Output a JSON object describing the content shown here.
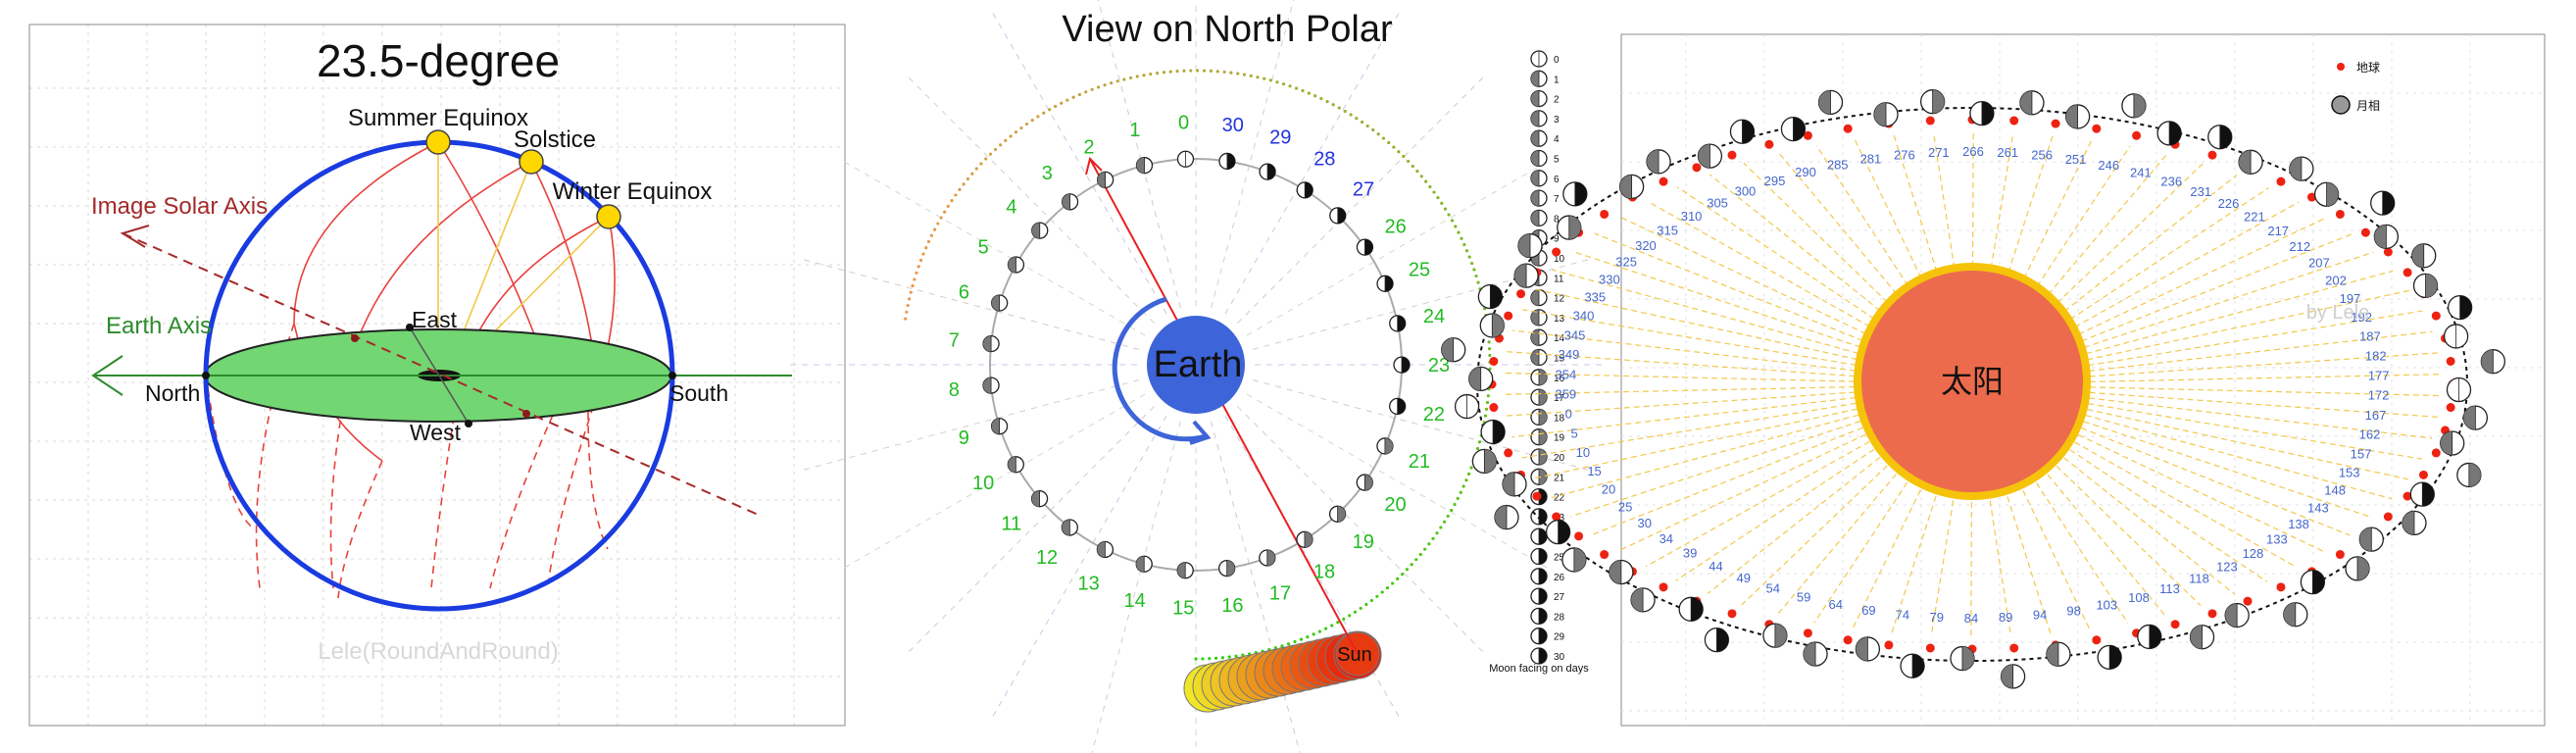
{
  "panel1": {
    "title": "23.5-degree",
    "summer_equinox": "Summer Equinox",
    "solstice": "Solstice",
    "winter_equinox": "Winter Equinox",
    "image_solar_axis": "Image Solar Axis",
    "earth_axis": "Earth Axis",
    "north": "North",
    "south": "South",
    "east": "East",
    "west": "West",
    "watermark": "Lele(RoundAndRound)",
    "colors": {
      "sphere": "#1a3be0",
      "disk": "#72d672",
      "arc": "#e8413c",
      "solar_axis": "#a52a2a",
      "sun": "#ffd700",
      "earth_axis": "#2e8b2e"
    }
  },
  "panel2": {
    "title": "View on North Polar",
    "earth_label": "Earth",
    "sun_label": "Sun",
    "green_days": [
      "0",
      "1",
      "2",
      "3",
      "4",
      "5",
      "6",
      "7",
      "8",
      "9",
      "10",
      "11",
      "12",
      "13",
      "14",
      "15",
      "16",
      "17",
      "18",
      "19",
      "20",
      "21",
      "22",
      "23",
      "24",
      "25",
      "26"
    ],
    "blue_days": [
      "27",
      "28",
      "29",
      "30"
    ],
    "legend_days": [
      "0",
      "1",
      "2",
      "3",
      "4",
      "5",
      "6",
      "7",
      "8",
      "9",
      "10",
      "11",
      "12",
      "13",
      "14",
      "15",
      "16",
      "17",
      "18",
      "19",
      "20",
      "21",
      "22",
      "23",
      "24",
      "25",
      "26",
      "27",
      "28",
      "29",
      "30"
    ],
    "legend_caption": "Moon facing on days",
    "colors": {
      "earth": "#3d64d8",
      "green_label": "#22bb22",
      "blue_label": "#2233dd",
      "sun": "#e83a10"
    }
  },
  "panel3": {
    "sun_label": "太阳",
    "watermark": "by Lele",
    "legend_earth": "地球",
    "legend_moon": "月相",
    "day_labels": [
      "359",
      "354",
      "349",
      "345",
      "340",
      "335",
      "330",
      "325",
      "320",
      "315",
      "310",
      "305",
      "300",
      "295",
      "290",
      "285",
      "281",
      "276",
      "271",
      "266",
      "261",
      "256",
      "251",
      "246",
      "241",
      "236",
      "231",
      "226",
      "221",
      "217",
      "212",
      "207",
      "202",
      "197",
      "192",
      "187",
      "182",
      "177",
      "172",
      "167",
      "162",
      "157",
      "153",
      "148",
      "143",
      "138",
      "133",
      "128",
      "123",
      "118",
      "113",
      "108",
      "103",
      "98",
      "94",
      "89",
      "84",
      "79",
      "74",
      "69",
      "64",
      "59",
      "54",
      "49",
      "44",
      "39",
      "34",
      "30",
      "25",
      "20",
      "15",
      "10",
      "5",
      "0"
    ],
    "colors": {
      "sun_fill": "#ec6b4c",
      "sun_ring": "#f5c30a",
      "earth_dot": "#ee2211",
      "label": "#4466cc",
      "ray": "#f2c84b"
    }
  }
}
